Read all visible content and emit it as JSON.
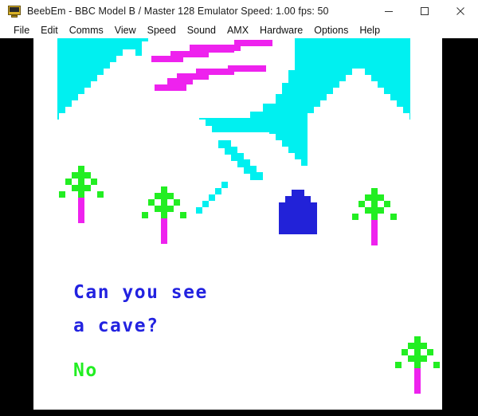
{
  "window": {
    "icon": "bbc-micro-monitor-icon",
    "title": "BeebEm - BBC Model B / Master 128 Emulator  Speed: 1.00  fps: 50",
    "app_name": "BeebEm",
    "machine": "BBC Model B / Master 128 Emulator",
    "speed_label": "Speed: 1.00",
    "fps_label": "fps: 50",
    "controls": {
      "minimize": "minimize-icon",
      "maximize": "maximize-icon",
      "close": "close-icon"
    }
  },
  "menubar": {
    "items": [
      {
        "label": "File"
      },
      {
        "label": "Edit"
      },
      {
        "label": "Comms"
      },
      {
        "label": "View"
      },
      {
        "label": "Speed"
      },
      {
        "label": "Sound"
      },
      {
        "label": "AMX"
      },
      {
        "label": "Hardware"
      },
      {
        "label": "Options"
      },
      {
        "label": "Help"
      }
    ]
  },
  "screen": {
    "background": "#ffffff",
    "sky_color": "#00f0f0",
    "mountain_color": "#ffffff",
    "bird_color": "#ee22ee",
    "tree_leaf_color": "#22ee22",
    "tree_trunk_color": "#ee22ee",
    "cave_color": "#2222d8",
    "prompt_line_1": "Can you see",
    "prompt_line_2": "a cave?",
    "prompt_color": "#2222e0",
    "answer": "No",
    "answer_color": "#22ee22",
    "objects": [
      {
        "name": "mountain-left",
        "type": "terrain"
      },
      {
        "name": "mountain-right",
        "type": "terrain"
      },
      {
        "name": "cloud-with-birds",
        "type": "sky"
      },
      {
        "name": "tree-1",
        "type": "tree"
      },
      {
        "name": "tree-2",
        "type": "tree"
      },
      {
        "name": "tree-3",
        "type": "tree"
      },
      {
        "name": "tree-4",
        "type": "tree"
      },
      {
        "name": "cave-entrance",
        "type": "cave"
      }
    ]
  }
}
